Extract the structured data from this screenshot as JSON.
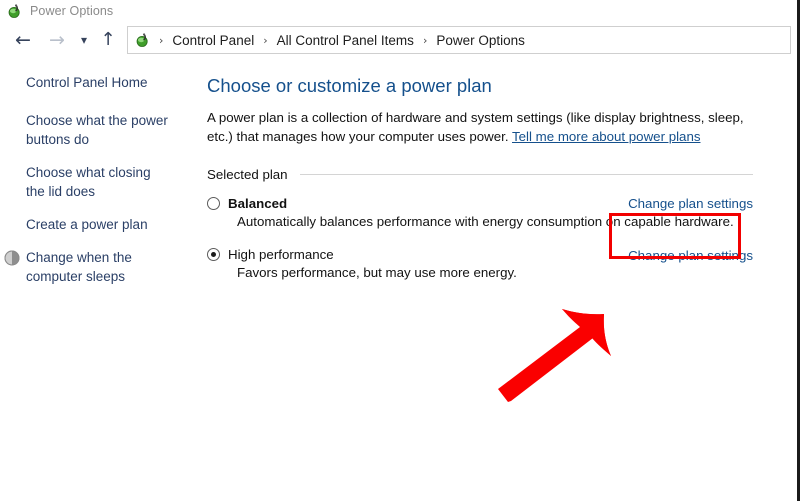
{
  "window": {
    "title": "Power Options",
    "title_icon": "power-plug-icon"
  },
  "nav": {
    "back_icon": "back-arrow-icon",
    "forward_icon": "forward-arrow-icon",
    "recent_icon": "chevron-down-icon",
    "up_icon": "up-arrow-icon",
    "address_icon": "power-plug-icon",
    "separator": "›",
    "breadcrumbs": [
      {
        "label": "Control Panel"
      },
      {
        "label": "All Control Panel Items"
      },
      {
        "label": "Power Options"
      }
    ]
  },
  "sidebar": {
    "items": [
      {
        "label": "Control Panel Home",
        "icon": null
      },
      {
        "label": "Choose what the power buttons do",
        "icon": null
      },
      {
        "label": "Choose what closing the lid does",
        "icon": null
      },
      {
        "label": "Create a power plan",
        "icon": null
      },
      {
        "label": "Change when the computer sleeps",
        "icon": "sleep-shield-icon"
      }
    ]
  },
  "main": {
    "page_title": "Choose or customize a power plan",
    "intro_text": "A power plan is a collection of hardware and system settings (like display brightness, sleep, etc.) that manages how your computer uses power. ",
    "intro_link": "Tell me more about power plans",
    "group_label": "Selected plan",
    "plans": [
      {
        "name": "Balanced",
        "description": "Automatically balances performance with energy consumption on capable hardware.",
        "selected": false,
        "bold": true,
        "action_label": "Change plan settings"
      },
      {
        "name": "High performance",
        "description": "Favors performance, but may use more energy.",
        "selected": true,
        "bold": false,
        "action_label": "Change plan settings"
      }
    ]
  },
  "annotations": {
    "highlight_color": "#f20000",
    "arrow_color": "#fa0000",
    "highlight_target": "Change plan settings",
    "arrow_direction": "up-right"
  },
  "colors": {
    "link_blue": "#15508c",
    "title_blue": "#15508c",
    "text_black": "#121212",
    "title_gray": "#8a8a8a",
    "accent_red": "#f20000"
  }
}
